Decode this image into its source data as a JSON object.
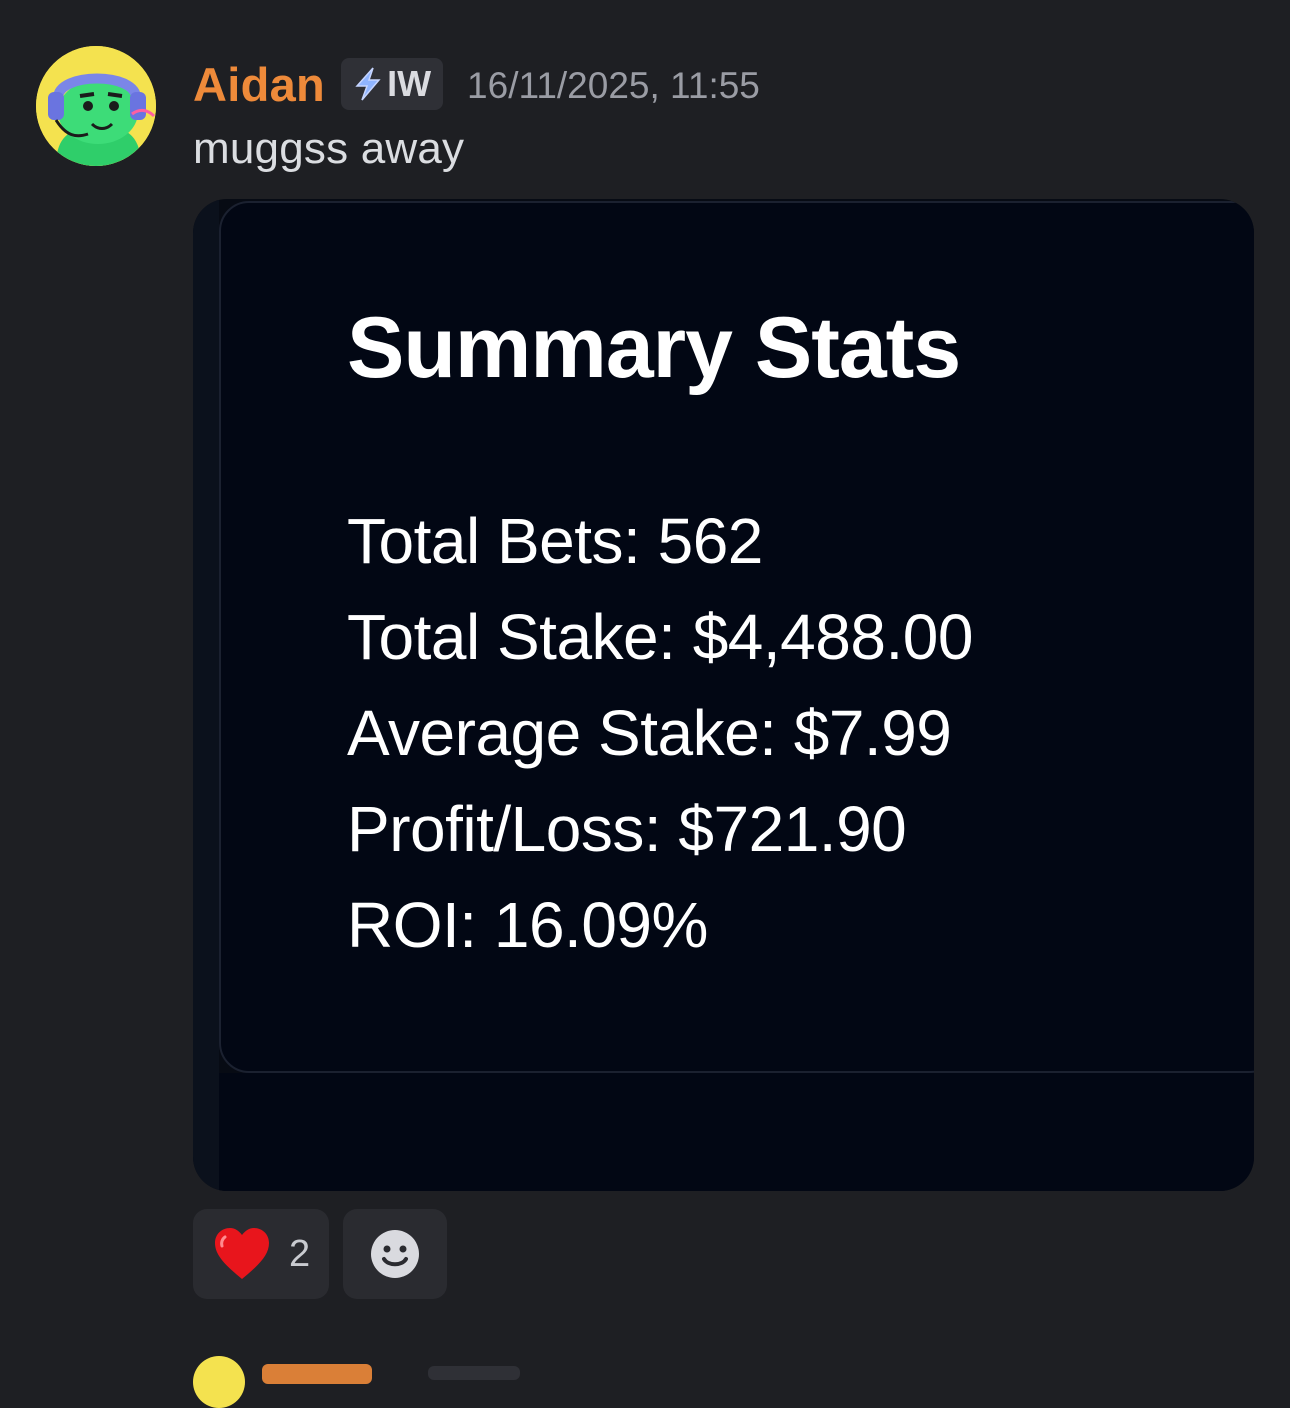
{
  "message": {
    "username": "Aidan",
    "tag": "IW",
    "tag_icon": "lightning-icon",
    "timestamp": "16/11/2025, 11:55",
    "text": "muggss away"
  },
  "attachment": {
    "title": "Summary Stats",
    "stats": [
      "Total Bets: 562",
      "Total Stake: $4,488.00",
      "Average Stake: $7.99",
      "Profit/Loss: $721.90",
      "ROI: 16.09%"
    ]
  },
  "reactions": [
    {
      "emoji": "heart-icon",
      "count": "2"
    },
    {
      "emoji": "add-reaction-icon"
    }
  ],
  "colors": {
    "background": "#1e1f23",
    "username": "#ee8a3a",
    "card": "#020714"
  }
}
